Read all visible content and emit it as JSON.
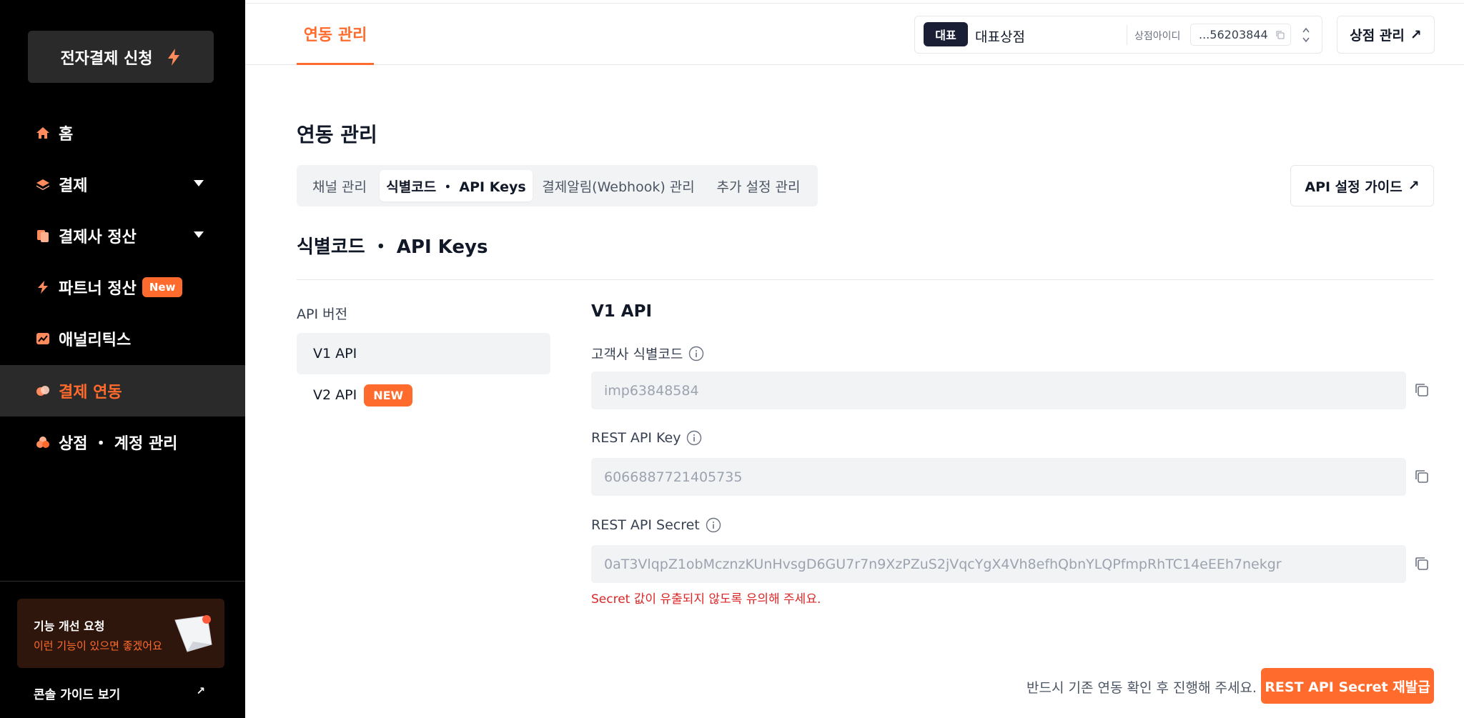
{
  "colors": {
    "accent": "#ff6b2c",
    "sidebar_bg": "#000000",
    "danger": "#dc2626"
  },
  "sidebar": {
    "apply_button": "전자결제 신청",
    "items": [
      {
        "label": "홈",
        "icon": "home-icon"
      },
      {
        "label": "결제",
        "icon": "layers-icon",
        "expandable": true
      },
      {
        "label": "결제사 정산",
        "icon": "documents-icon",
        "expandable": true
      },
      {
        "label": "파트너 정산",
        "icon": "bolt-icon",
        "badge": "New"
      },
      {
        "label": "애널리틱스",
        "icon": "chart-icon"
      },
      {
        "label": "결제 연동",
        "icon": "link-icon",
        "active": true
      },
      {
        "label": "상점 ・ 계정 관리",
        "icon": "store-icon"
      }
    ],
    "feedback": {
      "title": "기능 개선 요청",
      "subtitle": "이런 기능이 있으면 좋겠어요"
    },
    "guide_link": "콘솔 가이드 보기"
  },
  "topbar": {
    "tab": "연동 관리",
    "store": {
      "badge": "대표",
      "name": "대표상점",
      "id_label": "상점아이디",
      "id_value": "...56203844"
    },
    "store_manage": "상점 관리"
  },
  "main": {
    "title": "연동 관리",
    "tabs": [
      "채널 관리",
      "식별코드 ・ API Keys",
      "결제알림(Webhook) 관리",
      "추가 설정 관리"
    ],
    "api_guide": "API 설정 가이드",
    "section_title": "식별코드 ・ API Keys",
    "version_label": "API 버전",
    "versions": [
      {
        "label": "V1 API",
        "active": true
      },
      {
        "label": "V2 API",
        "badge": "NEW"
      }
    ],
    "v1": {
      "title": "V1 API",
      "fields": [
        {
          "label": "고객사 식별코드",
          "value": "imp63848584"
        },
        {
          "label": "REST API Key",
          "value": "6066887721405735"
        },
        {
          "label": "REST API Secret",
          "value": "0aT3VlqpZ1obMcznzKUnHvsgD6GU7r7n9XzPZuS2jVqcYgX4Vh8efhQbnYLQPfmpRhTC14eEEh7nekgr"
        }
      ],
      "warning": "Secret 값이 유출되지 않도록 유의해 주세요."
    },
    "footer_note": "반드시 기존 연동 확인 후 진행해 주세요.",
    "reissue_button": "REST API Secret 재발급"
  }
}
